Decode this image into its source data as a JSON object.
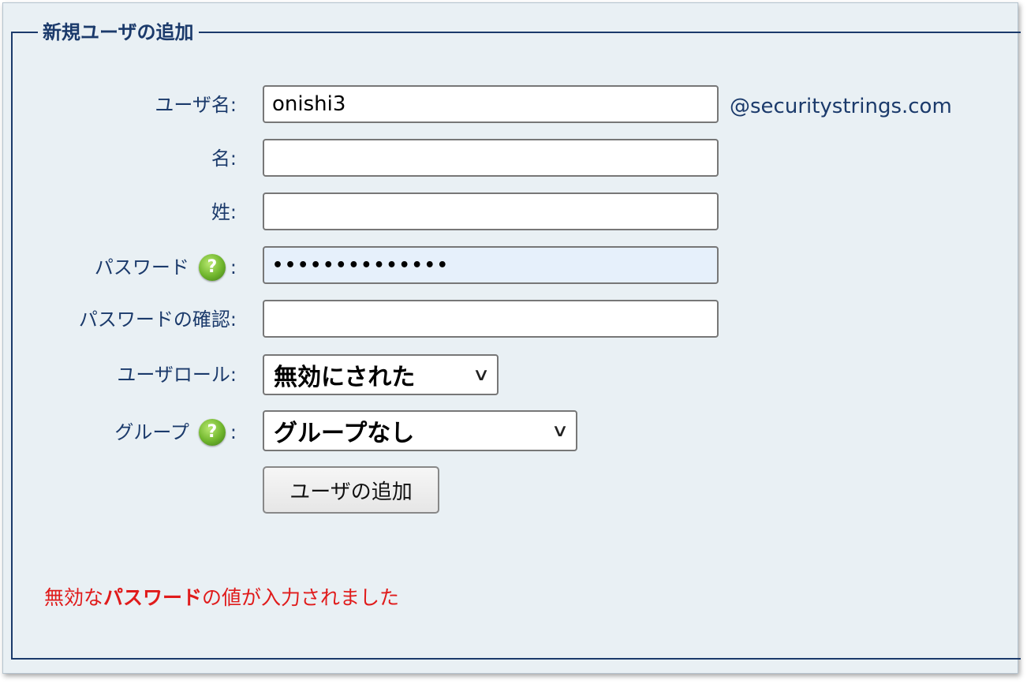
{
  "legend": "新規ユーザの追加",
  "fields": {
    "username": {
      "label": "ユーザ名:",
      "value": "onishi3",
      "suffix": "@securitystrings.com"
    },
    "first_name": {
      "label": "名:",
      "value": ""
    },
    "last_name": {
      "label": "姓:",
      "value": ""
    },
    "password": {
      "label": "パスワード",
      "colon": ":",
      "value": "••••••••••••••",
      "help_icon": "help-icon"
    },
    "password_confirm": {
      "label": "パスワードの確認:",
      "value": ""
    },
    "user_role": {
      "label": "ユーザロール:",
      "selected": "無効にされた"
    },
    "group": {
      "label": "グループ",
      "colon": ":",
      "selected": "グループなし",
      "help_icon": "help-icon"
    }
  },
  "submit_label": "ユーザの追加",
  "error": {
    "prefix": "無効な",
    "emphasis": "パスワード",
    "suffix": "の値が入力されました"
  },
  "colors": {
    "label": "#1b3a6b",
    "error": "#e01b1b",
    "panel_bg": "#e9f0f4",
    "password_bg": "#e6f0fb"
  }
}
